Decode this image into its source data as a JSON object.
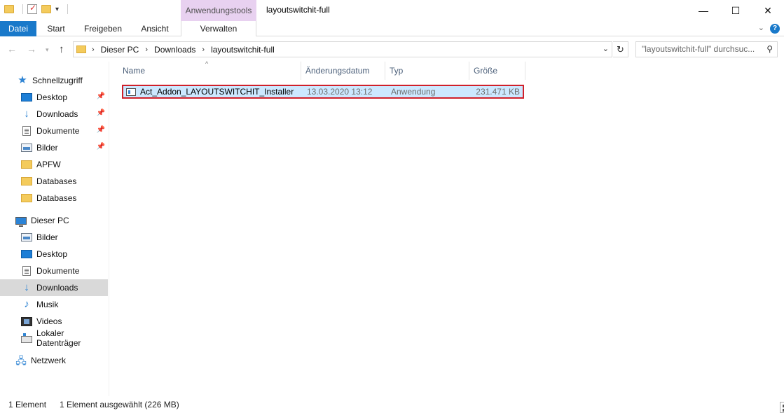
{
  "window": {
    "title": "layoutswitchit-full",
    "contextual_tab": "Anwendungstools",
    "controls": {
      "minimize": "—",
      "maximize": "☐",
      "close": "✕"
    }
  },
  "ribbon": {
    "tabs": [
      "Datei",
      "Start",
      "Freigeben",
      "Ansicht",
      "Verwalten"
    ],
    "expand_icon": "⌄",
    "help": "?"
  },
  "address": {
    "crumbs": [
      "Dieser PC",
      "Downloads",
      "layoutswitchit-full"
    ],
    "search_placeholder": "\"layoutswitchit-full\" durchsuc..."
  },
  "sidebar": {
    "quick_access": "Schnellzugriff",
    "quick_items": [
      {
        "label": "Desktop",
        "icon": "desktop-icon",
        "pinned": true
      },
      {
        "label": "Downloads",
        "icon": "download-icon",
        "pinned": true
      },
      {
        "label": "Dokumente",
        "icon": "document-icon",
        "pinned": true
      },
      {
        "label": "Bilder",
        "icon": "pictures-icon",
        "pinned": true
      },
      {
        "label": "APFW",
        "icon": "folder-icon",
        "pinned": false
      },
      {
        "label": "Databases",
        "icon": "folder-icon",
        "pinned": false
      },
      {
        "label": "Databases",
        "icon": "folder-icon",
        "pinned": false
      }
    ],
    "this_pc": "Dieser PC",
    "pc_items": [
      {
        "label": "Bilder",
        "icon": "pictures-icon"
      },
      {
        "label": "Desktop",
        "icon": "desktop-icon"
      },
      {
        "label": "Dokumente",
        "icon": "document-icon"
      },
      {
        "label": "Downloads",
        "icon": "download-icon",
        "selected": true
      },
      {
        "label": "Musik",
        "icon": "music-icon"
      },
      {
        "label": "Videos",
        "icon": "video-icon"
      },
      {
        "label": "Lokaler Datenträger",
        "icon": "drive-icon"
      }
    ],
    "network": "Netzwerk"
  },
  "columns": [
    "Name",
    "Änderungsdatum",
    "Typ",
    "Größe"
  ],
  "files": [
    {
      "name": "Act_Addon_LAYOUTSWITCHIT_Installer",
      "date": "13.03.2020 13:12",
      "type": "Anwendung",
      "size": "231.471 KB"
    }
  ],
  "status": {
    "count": "1 Element",
    "selection": "1 Element ausgewählt (226 MB)"
  },
  "colors": {
    "accent": "#1979ca",
    "contextual_tab_bg": "#e8d1f0",
    "selection_bg": "#cce8ff",
    "highlight_border": "#d0202a"
  }
}
